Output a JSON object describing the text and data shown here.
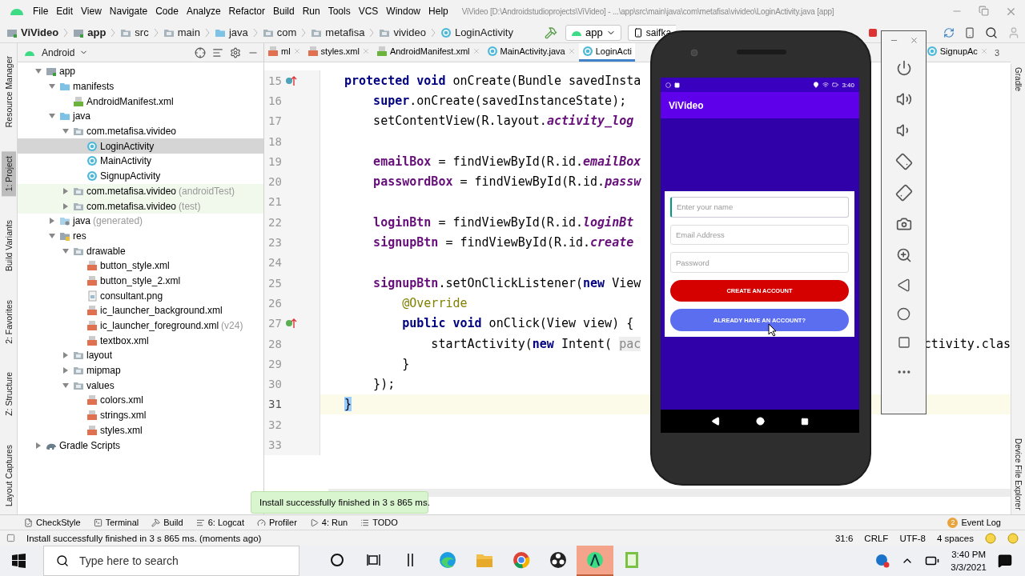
{
  "window": {
    "title": "ViVideo [D:\\Androidstudioprojects\\ViVideo] - ...\\app\\src\\main\\java\\com\\metafisa\\vivideo\\LoginActivity.java [app]"
  },
  "menu": [
    "File",
    "Edit",
    "View",
    "Navigate",
    "Code",
    "Analyze",
    "Refactor",
    "Build",
    "Run",
    "Tools",
    "VCS",
    "Window",
    "Help"
  ],
  "breadcrumbs": [
    {
      "label": "ViVideo",
      "kind": "project"
    },
    {
      "label": "app",
      "kind": "module"
    },
    {
      "label": "src",
      "kind": "folder"
    },
    {
      "label": "main",
      "kind": "folder"
    },
    {
      "label": "java",
      "kind": "source"
    },
    {
      "label": "com",
      "kind": "folder"
    },
    {
      "label": "metafisa",
      "kind": "folder"
    },
    {
      "label": "vivideo",
      "kind": "folder"
    },
    {
      "label": "LoginActivity",
      "kind": "class"
    }
  ],
  "toolbar": {
    "run_config": "app",
    "device": "saifka"
  },
  "left_tools": [
    {
      "label": "Resource Manager",
      "selected": false
    },
    {
      "label": "1: Project",
      "selected": true
    },
    {
      "label": "Build Variants",
      "selected": false
    },
    {
      "label": "2: Favorites",
      "selected": false
    },
    {
      "label": "Z: Structure",
      "selected": false
    },
    {
      "label": "Layout Captures",
      "selected": false
    }
  ],
  "project_panel": {
    "view": "Android",
    "tree": [
      {
        "label": "app",
        "kind": "module",
        "expanded": true,
        "selected": false,
        "children": [
          {
            "label": "manifests",
            "kind": "source",
            "expanded": true,
            "selected": false,
            "children": [
              {
                "label": "AndroidManifest.xml",
                "kind": "manifest",
                "selected": false
              }
            ]
          },
          {
            "label": "java",
            "kind": "source",
            "expanded": true,
            "selected": false,
            "children": [
              {
                "label": "com.metafisa.vivideo",
                "kind": "package",
                "expanded": true,
                "selected": false,
                "children": [
                  {
                    "label": "LoginActivity",
                    "kind": "class",
                    "selected": true
                  },
                  {
                    "label": "MainActivity",
                    "kind": "class",
                    "selected": false
                  },
                  {
                    "label": "SignupActivity",
                    "kind": "class",
                    "selected": false
                  }
                ]
              },
              {
                "label": "com.metafisa.vivideo",
                "suffix": "(androidTest)",
                "kind": "test-package",
                "expanded": false,
                "selected": false
              },
              {
                "label": "com.metafisa.vivideo",
                "suffix": "(test)",
                "kind": "test-package",
                "expanded": false,
                "selected": false
              }
            ]
          },
          {
            "label": "java",
            "suffix": "(generated)",
            "kind": "generated",
            "expanded": false,
            "selected": false
          },
          {
            "label": "res",
            "kind": "resources",
            "expanded": true,
            "selected": false,
            "children": [
              {
                "label": "drawable",
                "kind": "package",
                "expanded": true,
                "selected": false,
                "children": [
                  {
                    "label": "button_style.xml",
                    "kind": "xml",
                    "selected": false
                  },
                  {
                    "label": "button_style_2.xml",
                    "kind": "xml",
                    "selected": false
                  },
                  {
                    "label": "consultant.png",
                    "kind": "image",
                    "selected": false
                  },
                  {
                    "label": "ic_launcher_background.xml",
                    "kind": "xml",
                    "selected": false
                  },
                  {
                    "label": "ic_launcher_foreground.xml",
                    "suffix": "(v24)",
                    "kind": "xml",
                    "selected": false
                  },
                  {
                    "label": "textbox.xml",
                    "kind": "xml",
                    "selected": false
                  }
                ]
              },
              {
                "label": "layout",
                "kind": "package",
                "expanded": false,
                "selected": false
              },
              {
                "label": "mipmap",
                "kind": "package",
                "expanded": false,
                "selected": false
              },
              {
                "label": "values",
                "kind": "package",
                "expanded": true,
                "selected": false,
                "children": [
                  {
                    "label": "colors.xml",
                    "kind": "xml",
                    "selected": false
                  },
                  {
                    "label": "strings.xml",
                    "kind": "xml",
                    "selected": false
                  },
                  {
                    "label": "styles.xml",
                    "kind": "xml",
                    "selected": false
                  }
                ]
              }
            ]
          }
        ]
      },
      {
        "label": "Gradle Scripts",
        "kind": "gradle",
        "expanded": false,
        "selected": false
      }
    ]
  },
  "editor": {
    "tabs": [
      {
        "label": "ml",
        "kind": "xml",
        "selected": false
      },
      {
        "label": "styles.xml",
        "kind": "xml",
        "selected": false
      },
      {
        "label": "AndroidManifest.xml",
        "kind": "manifest",
        "selected": false
      },
      {
        "label": "MainActivity.java",
        "kind": "class",
        "selected": false
      },
      {
        "label": "LoginActi",
        "kind": "class",
        "selected": true
      },
      {
        "label": "SignupAc",
        "kind": "class",
        "selected": false
      }
    ],
    "overflow_count": "3",
    "lines": [
      {
        "number": "15",
        "kind": "overriding-method",
        "current": false,
        "segments": [
          {
            "kind": "keyword",
            "text": "protected void"
          },
          {
            "kind": "plain",
            "text": " onCreate(Bundle savedInsta"
          }
        ]
      },
      {
        "number": "16",
        "current": false,
        "segments": [
          {
            "kind": "keyword",
            "text": "    super"
          },
          {
            "kind": "plain",
            "text": ".onCreate(savedInstanceState);"
          }
        ]
      },
      {
        "number": "17",
        "current": false,
        "segments": [
          {
            "kind": "plain",
            "text": "    setContentView(R.layout."
          },
          {
            "kind": "static",
            "text": "activity_log"
          }
        ]
      },
      {
        "number": "18",
        "current": false
      },
      {
        "number": "19",
        "current": false,
        "segments": [
          {
            "kind": "field",
            "text": "    emailBox"
          },
          {
            "kind": "plain",
            "text": " = findViewById(R.id."
          },
          {
            "kind": "static",
            "text": "emailBox"
          }
        ]
      },
      {
        "number": "20",
        "current": false,
        "segments": [
          {
            "kind": "field",
            "text": "    passwordBox"
          },
          {
            "kind": "plain",
            "text": " = findViewById(R.id."
          },
          {
            "kind": "static",
            "text": "passw"
          }
        ]
      },
      {
        "number": "21",
        "current": false
      },
      {
        "number": "22",
        "current": false,
        "segments": [
          {
            "kind": "field",
            "text": "    loginBtn"
          },
          {
            "kind": "plain",
            "text": " = findViewById(R.id."
          },
          {
            "kind": "static",
            "text": "loginBt"
          }
        ]
      },
      {
        "number": "23",
        "current": false,
        "segments": [
          {
            "kind": "field",
            "text": "    signupBtn"
          },
          {
            "kind": "plain",
            "text": " = findViewById(R.id."
          },
          {
            "kind": "static",
            "text": "create"
          }
        ]
      },
      {
        "number": "24",
        "current": false
      },
      {
        "number": "25",
        "current": false,
        "segments": [
          {
            "kind": "field",
            "text": "    signupBtn"
          },
          {
            "kind": "plain",
            "text": ".setOnClickListener("
          },
          {
            "kind": "keyword",
            "text": "new"
          },
          {
            "kind": "plain",
            "text": " View"
          }
        ]
      },
      {
        "number": "26",
        "current": false,
        "segments": [
          {
            "kind": "annotation",
            "text": "        @Override"
          }
        ]
      },
      {
        "number": "27",
        "kind": "implementing-method",
        "current": false,
        "segments": [
          {
            "kind": "keyword",
            "text": "        public void"
          },
          {
            "kind": "plain",
            "text": " onClick(View view) {"
          }
        ]
      },
      {
        "number": "28",
        "current": false,
        "segments": [
          {
            "kind": "plain",
            "text": "            startActivity("
          },
          {
            "kind": "keyword",
            "text": "new"
          },
          {
            "kind": "plain",
            "text": " Intent( "
          },
          {
            "kind": "hint",
            "text": "pac"
          }
        ],
        "tail": "ctivity.clas"
      },
      {
        "number": "29",
        "current": false,
        "segments": [
          {
            "kind": "plain",
            "text": "        }"
          }
        ]
      },
      {
        "number": "30",
        "current": false,
        "segments": [
          {
            "kind": "plain",
            "text": "    });"
          }
        ]
      },
      {
        "number": "31",
        "current": true,
        "segments": [
          {
            "kind": "brace",
            "text": "}"
          }
        ]
      },
      {
        "number": "32",
        "current": false
      },
      {
        "number": "33",
        "current": false
      }
    ]
  },
  "right_tools": {
    "top": "Gradle",
    "bottom": "Device File Explorer"
  },
  "toast": "Install successfully finished in 3 s 865 ms.",
  "tool_windows": [
    {
      "label": "CheckStyle",
      "kind": "checkstyle"
    },
    {
      "label": "Terminal",
      "kind": "terminal"
    },
    {
      "label": "Build",
      "kind": "build"
    },
    {
      "label": "6: Logcat",
      "kind": "logcat"
    },
    {
      "label": "Profiler",
      "kind": "profiler"
    },
    {
      "label": "4: Run",
      "kind": "run"
    },
    {
      "label": "TODO",
      "kind": "todo"
    }
  ],
  "event_log": {
    "label": "Event Log",
    "count": "2"
  },
  "status_bar": {
    "message": "Install successfully finished in 3 s 865 ms. (moments ago)",
    "position": "31:6",
    "line_ending": "CRLF",
    "encoding": "UTF-8",
    "indent": "4 spaces"
  },
  "emulator": {
    "status_time": "3:40",
    "app_title": "ViVideo",
    "fields": [
      {
        "placeholder": "Enter your name",
        "focused": true
      },
      {
        "placeholder": "Email Address",
        "focused": false
      },
      {
        "placeholder": "Password",
        "focused": false
      }
    ],
    "buttons": [
      {
        "label": "CREATE AN ACCOUNT",
        "color": "#d50000"
      },
      {
        "label": "ALREADY HAVE AN ACCOUNT?",
        "color": "#5b6ef0"
      }
    ]
  },
  "taskbar": {
    "search_placeholder": "Type here to search",
    "apps": [
      {
        "kind": "cortana",
        "active": false
      },
      {
        "kind": "task-view",
        "active": false
      },
      {
        "kind": "bars",
        "active": false
      },
      {
        "kind": "edge",
        "active": false
      },
      {
        "kind": "files",
        "active": false
      },
      {
        "kind": "chrome",
        "active": false
      },
      {
        "kind": "obs",
        "active": false
      },
      {
        "kind": "android-studio",
        "active": true
      },
      {
        "kind": "notepad",
        "active": false
      }
    ],
    "time": "3:40 PM",
    "date": "3/3/2021"
  }
}
